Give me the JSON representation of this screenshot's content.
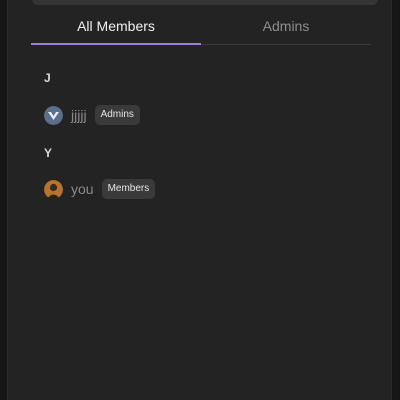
{
  "tabs": [
    {
      "label": "All Members",
      "active": true
    },
    {
      "label": "Admins",
      "active": false
    }
  ],
  "sections": [
    {
      "letter": "J",
      "members": [
        {
          "name": "jjjjj",
          "role": "Admins",
          "avatar_icon": "v-logo-avatar"
        }
      ]
    },
    {
      "letter": "Y",
      "members": [
        {
          "name": "you",
          "role": "Members",
          "avatar_icon": "person-photo-avatar"
        }
      ]
    }
  ],
  "colors": {
    "accent": "#9d7fd6",
    "panel": "#232323",
    "badge": "#3a3a3a"
  }
}
